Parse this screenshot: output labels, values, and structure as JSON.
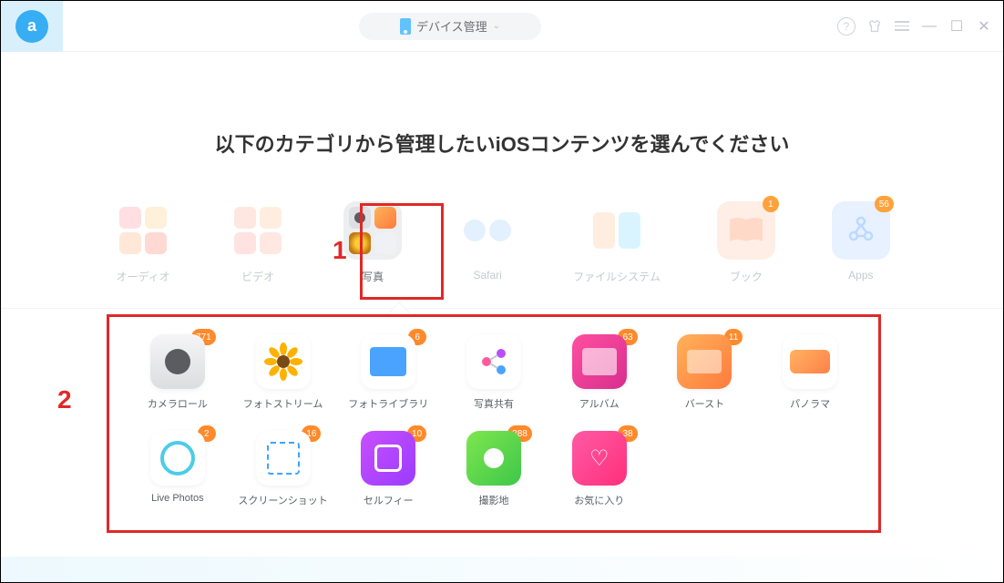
{
  "header": {
    "dropdown_label": "デバイス管理"
  },
  "heading": "以下のカテゴリから管理したいiOSコンテンツを選んでください",
  "annotations": {
    "one": "1",
    "two": "2"
  },
  "categories": [
    {
      "label": "オーディオ",
      "badge": null
    },
    {
      "label": "ビデオ",
      "badge": null
    },
    {
      "label": "写真",
      "badge": null
    },
    {
      "label": "Safari",
      "badge": null
    },
    {
      "label": "ファイルシステム",
      "badge": null
    },
    {
      "label": "ブック",
      "badge": "1"
    },
    {
      "label": "Apps",
      "badge": "56"
    }
  ],
  "subcategories": [
    {
      "label": "カメラロール",
      "badge": "771"
    },
    {
      "label": "フォトストリーム",
      "badge": null
    },
    {
      "label": "フォトライブラリ",
      "badge": "6"
    },
    {
      "label": "写真共有",
      "badge": null
    },
    {
      "label": "アルバム",
      "badge": "63"
    },
    {
      "label": "バースト",
      "badge": "11"
    },
    {
      "label": "パノラマ",
      "badge": null
    },
    {
      "label": "Live Photos",
      "badge": "2"
    },
    {
      "label": "スクリーンショット",
      "badge": "16"
    },
    {
      "label": "セルフィー",
      "badge": "10"
    },
    {
      "label": "撮影地",
      "badge": "388"
    },
    {
      "label": "お気に入り",
      "badge": "38"
    }
  ]
}
